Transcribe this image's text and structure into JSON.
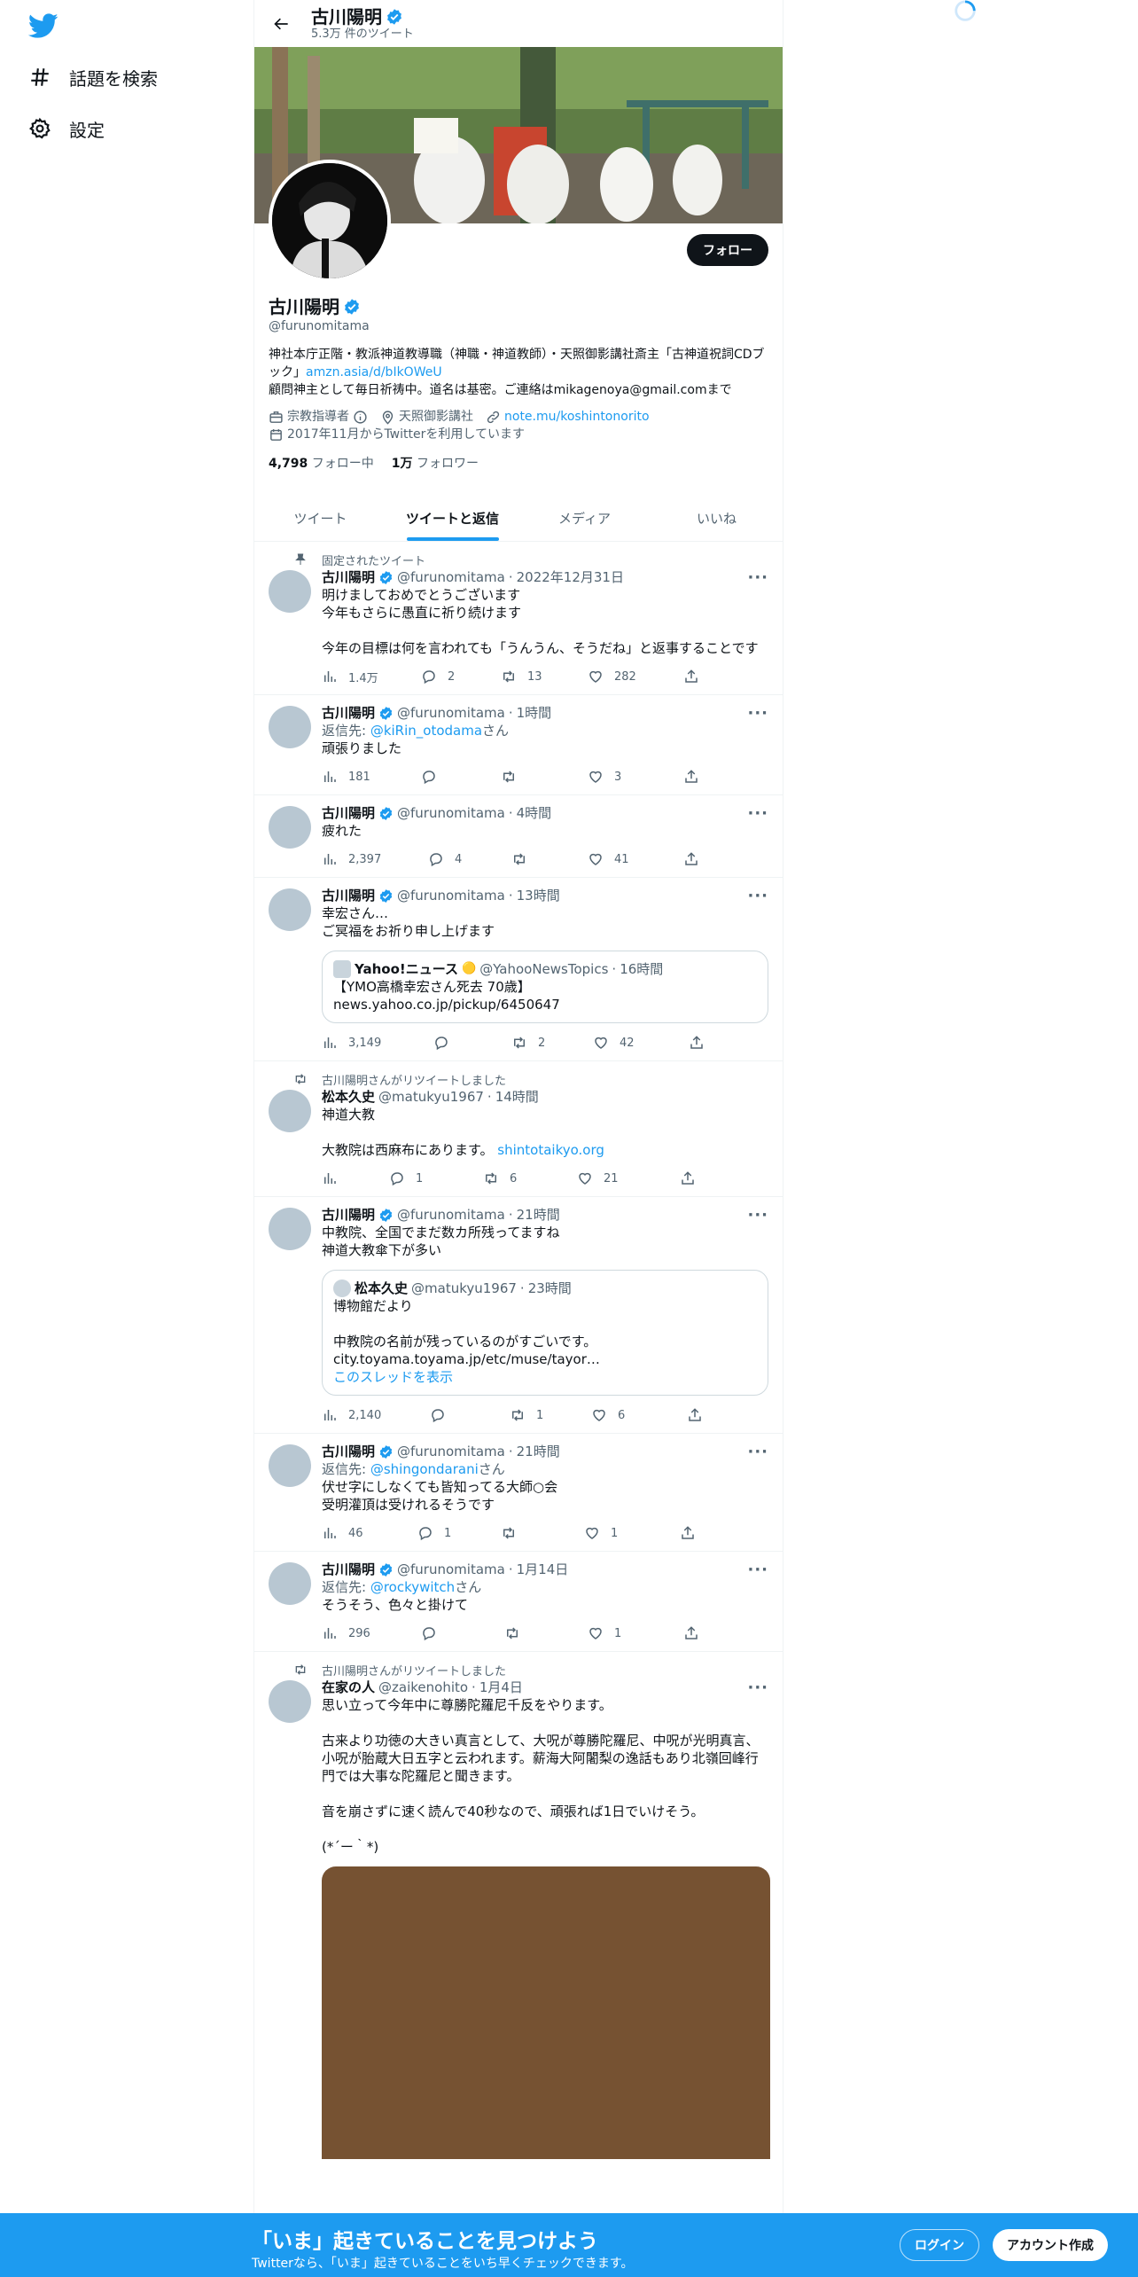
{
  "nav": {
    "explore_label": "話題を検索",
    "settings_label": "設定"
  },
  "header": {
    "name": "古川陽明",
    "tweet_count": "5.3万 件のツイート"
  },
  "profile": {
    "name": "古川陽明",
    "handle": "@furunomitama",
    "follow_label": "フォロー",
    "bio_line1": "神社本庁正階・教派神道教導職（神職・神道教師）・天照御影講社斎主「古神道祝詞CDブック」",
    "bio_link": "amzn.asia/d/bIkOWeU",
    "bio_line2": "顧問神主として毎日祈祷中。道名は基密。ご連絡はmikagenoya@gmail.comまで",
    "category": "宗教指導者",
    "location": "天照御影講社",
    "website": "note.mu/koshintonorito",
    "joined": "2017年11月からTwitterを利用しています",
    "following_count": "4,798",
    "following_label": "フォロー中",
    "followers_count": "1万",
    "followers_label": "フォロワー"
  },
  "tabs": [
    {
      "label": "ツイート"
    },
    {
      "label": "ツイートと返信"
    },
    {
      "label": "メディア"
    },
    {
      "label": "いいね"
    }
  ],
  "tweets": [
    {
      "context": "固定されたツイート",
      "name": "古川陽明",
      "handle": "@furunomitama",
      "time": "2022年12月31日",
      "text": "明けましておめでとうございます\n今年もさらに愚直に祈り続けます\n\n今年の目標は何を言われても「うんうん、そうだね」と返事することです",
      "views": "1.4万",
      "replies": "2",
      "retweets": "13",
      "likes": "282"
    },
    {
      "name": "古川陽明",
      "handle": "@furunomitama",
      "time": "1時間",
      "reply_prefix": "返信先: ",
      "reply_to": "@kiRin_otodama",
      "reply_suffix": "さん",
      "text": "頑張りました",
      "views": "181",
      "replies": "",
      "retweets": "",
      "likes": "3"
    },
    {
      "name": "古川陽明",
      "handle": "@furunomitama",
      "time": "4時間",
      "text": "疲れた",
      "views": "2,397",
      "replies": "4",
      "retweets": "",
      "likes": "41"
    },
    {
      "name": "古川陽明",
      "handle": "@furunomitama",
      "time": "13時間",
      "text": "幸宏さん…\nご冥福をお祈り申し上げます",
      "quote": {
        "name": "Yahoo!ニュース",
        "emoji": "🟡",
        "handle": "@YahooNewsTopics",
        "time": "16時間",
        "text": "【YMO高橋幸宏さん死去 70歳】\nnews.yahoo.co.jp/pickup/6450647"
      },
      "views": "3,149",
      "replies": "",
      "retweets": "2",
      "likes": "42"
    },
    {
      "context": "古川陽明さんがリツイートしました",
      "name": "松本久史",
      "handle": "@matukyu1967",
      "time": "14時間",
      "text": "神道大教\n\n大教院は西麻布にあります。 ",
      "text_link": "shintotaikyo.org",
      "views": "",
      "replies": "1",
      "retweets": "6",
      "likes": "21"
    },
    {
      "name": "古川陽明",
      "handle": "@furunomitama",
      "time": "21時間",
      "text": "中教院、全国でまだ数カ所残ってますね\n神道大教傘下が多い",
      "quote": {
        "name": "松本久史",
        "handle": "@matukyu1967",
        "time": "23時間",
        "text": "博物館だより\n\n中教院の名前が残っているのがすごいです。\ncity.toyama.toyama.jp/etc/muse/tayor…",
        "thread_label": "このスレッドを表示"
      },
      "views": "2,140",
      "replies": "",
      "retweets": "1",
      "likes": "6"
    },
    {
      "name": "古川陽明",
      "handle": "@furunomitama",
      "time": "21時間",
      "reply_prefix": "返信先: ",
      "reply_to": "@shingondarani",
      "reply_suffix": "さん",
      "text": "伏せ字にしなくても皆知ってる大師○会\n受明灌頂は受けれるそうです",
      "views": "46",
      "replies": "1",
      "retweets": "",
      "likes": "1"
    },
    {
      "name": "古川陽明",
      "handle": "@furunomitama",
      "time": "1月14日",
      "reply_prefix": "返信先: ",
      "reply_to": "@rockywitch",
      "reply_suffix": "さん",
      "text": "そうそう、色々と掛けて",
      "views": "296",
      "replies": "",
      "retweets": "",
      "likes": "1"
    },
    {
      "context": "古川陽明さんがリツイートしました",
      "name": "在家の人",
      "handle": "@zaikenohito",
      "time": "1月4日",
      "text": "思い立って今年中に尊勝陀羅尼千反をやります。\n\n古来より功徳の大きい真言として、大呪が尊勝陀羅尼、中呪が光明真言、小呪が胎蔵大日五字と云われます。薪海大阿闍梨の逸話もあり北嶺回峰行門では大事な陀羅尼と聞きます。\n\n音を崩さずに速く読んで40秒なので、頑張れば1日でいけそう。\n\n(*´ー｀*)"
    }
  ],
  "bottom_bar": {
    "title": "「いま」起きていることを見つけよう",
    "subtitle": "Twitterなら、「いま」起きていることをいち早くチェックできます。",
    "login_label": "ログイン",
    "signup_label": "アカウント作成"
  },
  "colors": {
    "accent": "#1d9bf0",
    "text": "#0f1419",
    "secondary": "#536471",
    "media_placeholder": "#765232"
  }
}
